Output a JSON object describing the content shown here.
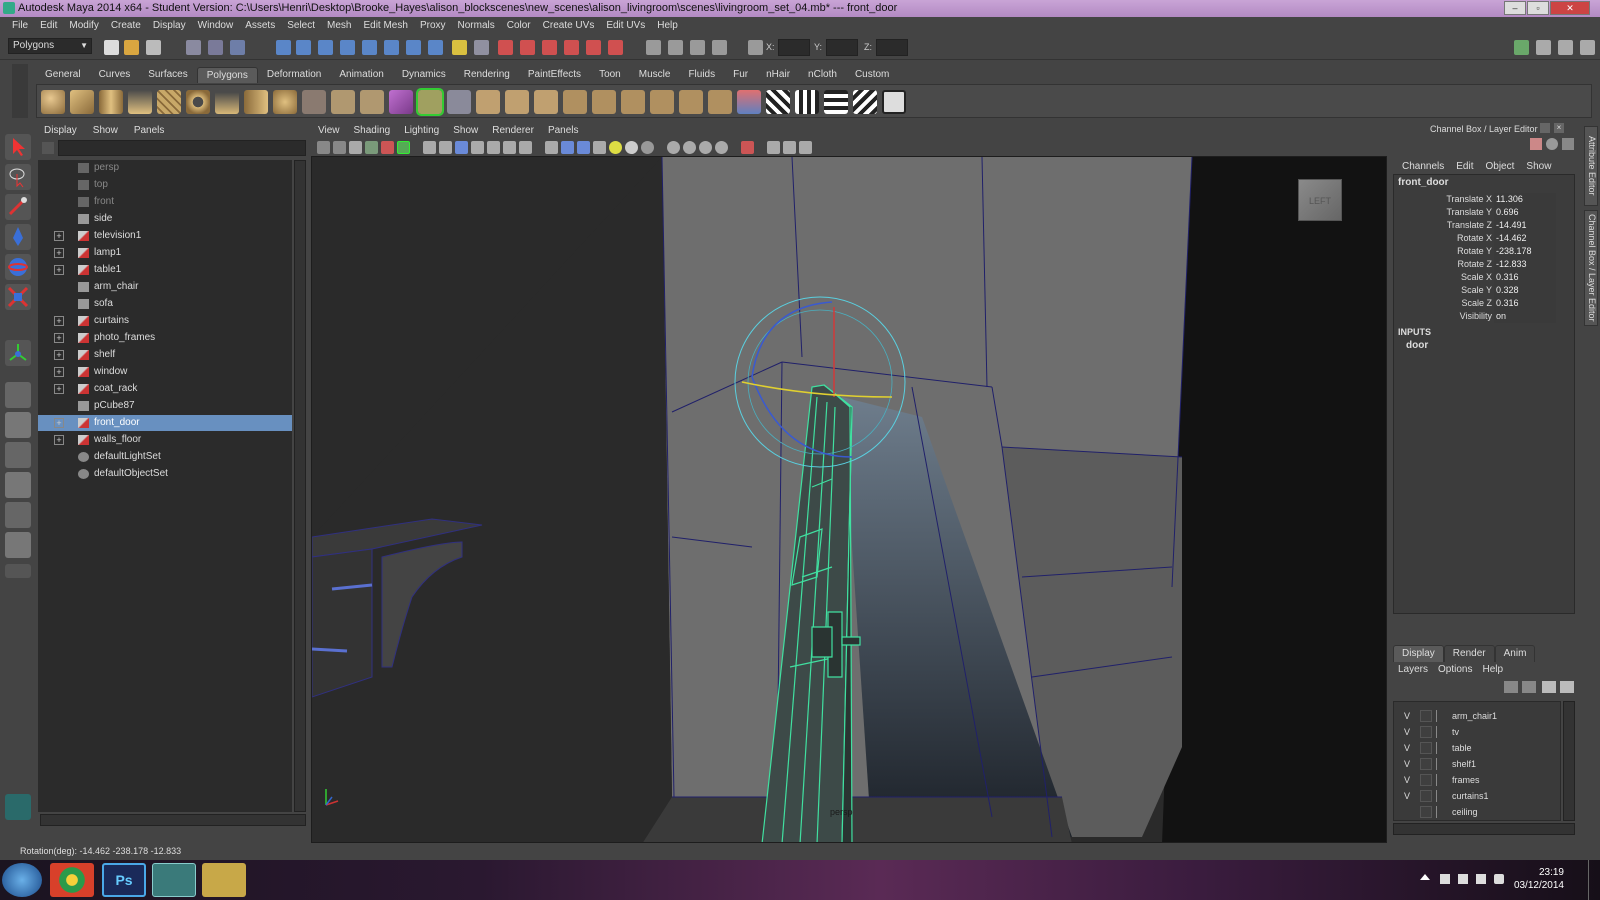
{
  "window": {
    "title": "Autodesk Maya 2014 x64 - Student Version: C:\\Users\\Henri\\Desktop\\Brooke_Hayes\\alison_blockscenes\\new_scenes\\alison_livingroom\\scenes\\livingroom_set_04.mb*   ---   front_door",
    "min": "‒",
    "max": "▫",
    "close": "✕"
  },
  "menubar": [
    "File",
    "Edit",
    "Modify",
    "Create",
    "Display",
    "Window",
    "Assets",
    "Select",
    "Mesh",
    "Edit Mesh",
    "Proxy",
    "Normals",
    "Color",
    "Create UVs",
    "Edit UVs",
    "Help"
  ],
  "statusline": {
    "mode": "Polygons",
    "x_label": "X:",
    "y_label": "Y:",
    "z_label": "Z:"
  },
  "shelf_tabs": [
    "General",
    "Curves",
    "Surfaces",
    "Polygons",
    "Deformation",
    "Animation",
    "Dynamics",
    "Rendering",
    "PaintEffects",
    "Toon",
    "Muscle",
    "Fluids",
    "Fur",
    "nHair",
    "nCloth",
    "Custom"
  ],
  "shelf_active": "Polygons",
  "outliner": {
    "menu": [
      "Display",
      "Show",
      "Panels"
    ],
    "items": [
      {
        "name": "persp",
        "expand": false,
        "dim": true
      },
      {
        "name": "top",
        "expand": false,
        "dim": true
      },
      {
        "name": "front",
        "expand": false,
        "dim": true
      },
      {
        "name": "side",
        "expand": false,
        "dim": false
      },
      {
        "name": "television1",
        "expand": true,
        "dim": false
      },
      {
        "name": "lamp1",
        "expand": true,
        "dim": false
      },
      {
        "name": "table1",
        "expand": true,
        "dim": false
      },
      {
        "name": "arm_chair",
        "expand": false,
        "dim": false
      },
      {
        "name": "sofa",
        "expand": false,
        "dim": false
      },
      {
        "name": "curtains",
        "expand": true,
        "dim": false
      },
      {
        "name": "photo_frames",
        "expand": true,
        "dim": false
      },
      {
        "name": "shelf",
        "expand": true,
        "dim": false
      },
      {
        "name": "window",
        "expand": true,
        "dim": false
      },
      {
        "name": "coat_rack",
        "expand": true,
        "dim": false
      },
      {
        "name": "pCube87",
        "expand": false,
        "dim": false
      },
      {
        "name": "front_door",
        "expand": true,
        "dim": false,
        "selected": true
      },
      {
        "name": "walls_floor",
        "expand": true,
        "dim": false
      },
      {
        "name": "defaultLightSet",
        "expand": false,
        "dim": false
      },
      {
        "name": "defaultObjectSet",
        "expand": false,
        "dim": false
      }
    ]
  },
  "viewport": {
    "menu": [
      "View",
      "Shading",
      "Lighting",
      "Show",
      "Renderer",
      "Panels"
    ],
    "viewcube_label": "LEFT",
    "camera_label": "persp"
  },
  "channel_box": {
    "title": "Channel Box / Layer Editor",
    "menu": [
      "Channels",
      "Edit",
      "Object",
      "Show"
    ],
    "object": "front_door",
    "attributes": [
      {
        "name": "Translate X",
        "value": "11.306"
      },
      {
        "name": "Translate Y",
        "value": "0.696"
      },
      {
        "name": "Translate Z",
        "value": "-14.491"
      },
      {
        "name": "Rotate X",
        "value": "-14.462"
      },
      {
        "name": "Rotate Y",
        "value": "-238.178"
      },
      {
        "name": "Rotate Z",
        "value": "-12.833"
      },
      {
        "name": "Scale X",
        "value": "0.316"
      },
      {
        "name": "Scale Y",
        "value": "0.328"
      },
      {
        "name": "Scale Z",
        "value": "0.316"
      },
      {
        "name": "Visibility",
        "value": "on"
      }
    ],
    "inputs_label": "INPUTS",
    "input_node": "door"
  },
  "layer_editor": {
    "tabs": [
      "Display",
      "Render",
      "Anim"
    ],
    "active_tab": "Display",
    "menu": [
      "Layers",
      "Options",
      "Help"
    ],
    "layers": [
      {
        "v": "V",
        "name": "arm_chair1"
      },
      {
        "v": "V",
        "name": "tv"
      },
      {
        "v": "V",
        "name": "table"
      },
      {
        "v": "V",
        "name": "shelf1"
      },
      {
        "v": "V",
        "name": "frames"
      },
      {
        "v": "V",
        "name": "curtains1"
      },
      {
        "v": "",
        "name": "ceiling"
      }
    ]
  },
  "side_tabs": [
    "Attribute Editor",
    "Channel Box / Layer Editor"
  ],
  "helpline": "Rotation(deg):  -14.462   -238.178   -12.833",
  "taskbar": {
    "time": "23:19",
    "date": "03/12/2014",
    "ps_label": "Ps"
  },
  "colors": {
    "selection": "#6890c0",
    "wire_selected": "#40e0a0",
    "title_bar": "#c0a0d0"
  }
}
